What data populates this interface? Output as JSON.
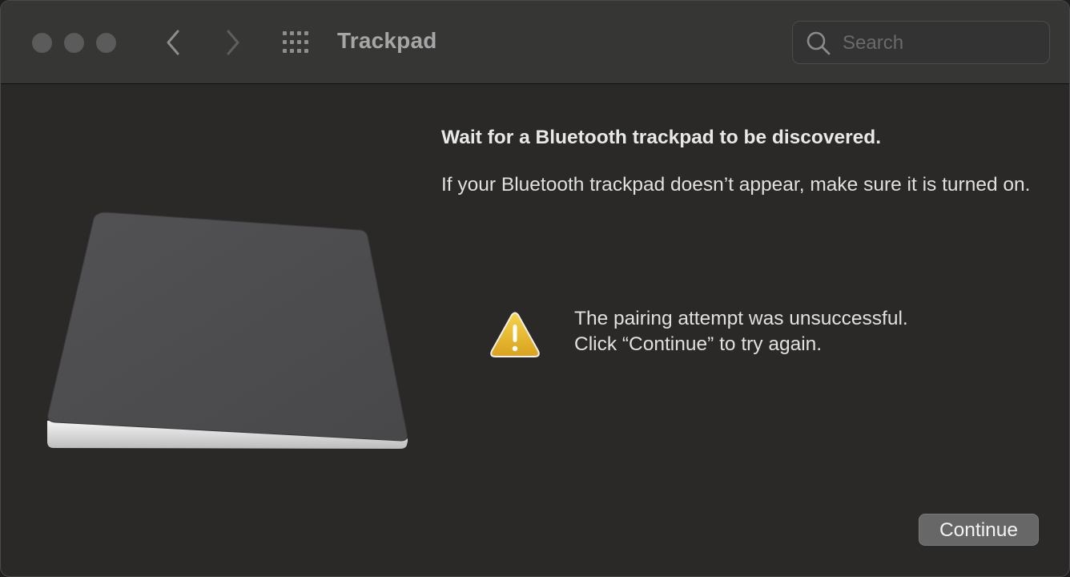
{
  "window": {
    "title": "Trackpad",
    "traffic_lights": [
      "close",
      "minimize",
      "zoom"
    ],
    "traffic_light_color": "#5b5b5b"
  },
  "toolbar": {
    "back_icon": "chevron-left-icon",
    "forward_icon": "chevron-right-icon",
    "grid_icon": "grid-icon"
  },
  "search": {
    "placeholder": "Search",
    "value": ""
  },
  "content": {
    "heading": "Wait for a Bluetooth trackpad to be discovered.",
    "description": "If your Bluetooth trackpad doesn’t appear, make sure it is turned on.",
    "status_line1": "The pairing attempt was unsuccessful.",
    "status_line2": "Click “Continue” to try again.",
    "status_icon": "warning-icon"
  },
  "buttons": {
    "continue_label": "Continue"
  },
  "colors": {
    "window_bg": "#2a2928",
    "titlebar_bg": "#363635",
    "warning": "#e8b62c",
    "button_bg": "#676767"
  }
}
